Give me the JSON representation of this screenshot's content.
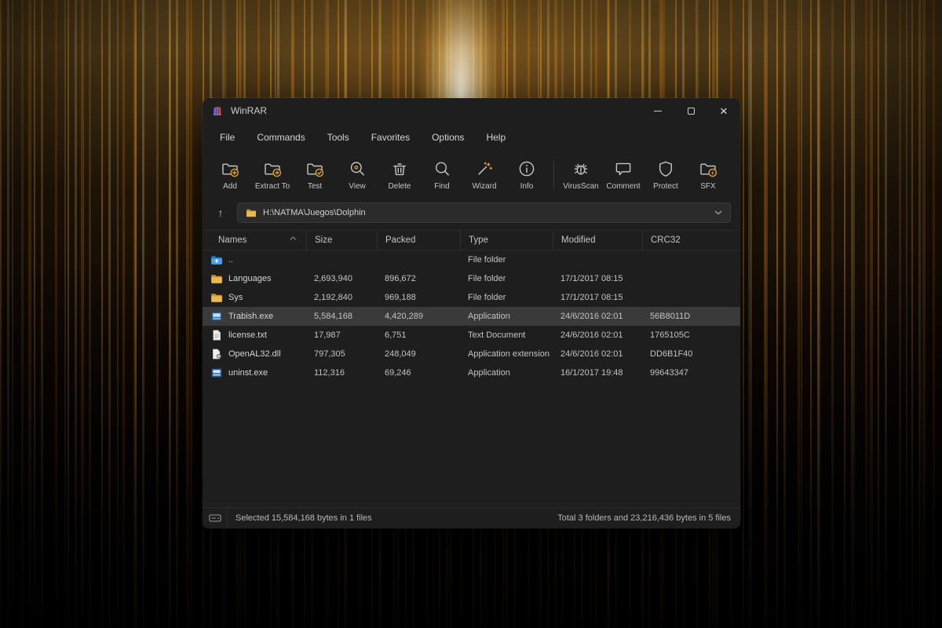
{
  "window": {
    "title": "WinRAR"
  },
  "colors": {
    "accent_gold": "#d9a13b",
    "window_bg": "#1e1e1e",
    "selection": "#3a3a3a",
    "folder_yellow": "#e9b850"
  },
  "menu": {
    "items": [
      "File",
      "Commands",
      "Tools",
      "Favorites",
      "Options",
      "Help"
    ]
  },
  "toolbar": {
    "buttons": [
      {
        "label": "Add",
        "icon": "add",
        "sep_after": false
      },
      {
        "label": "Extract To",
        "icon": "extract",
        "sep_after": false
      },
      {
        "label": "Test",
        "icon": "test",
        "sep_after": false
      },
      {
        "label": "View",
        "icon": "view",
        "sep_after": false
      },
      {
        "label": "Delete",
        "icon": "delete",
        "sep_after": false
      },
      {
        "label": "Find",
        "icon": "find",
        "sep_after": false
      },
      {
        "label": "Wizard",
        "icon": "wizard",
        "sep_after": false
      },
      {
        "label": "Info",
        "icon": "info",
        "sep_after": true
      },
      {
        "label": "VirusScan",
        "icon": "virusscan",
        "sep_after": false
      },
      {
        "label": "Comment",
        "icon": "comment",
        "sep_after": false
      },
      {
        "label": "Protect",
        "icon": "protect",
        "sep_after": false
      },
      {
        "label": "SFX",
        "icon": "sfx",
        "sep_after": false
      }
    ]
  },
  "address": {
    "path": "H:\\NATMA\\Juegos\\Dolphin",
    "up_icon": "up-arrow-icon",
    "folder_icon": "folder-icon",
    "dropdown_icon": "chevron-down-icon",
    "up_glyph": "↑"
  },
  "list": {
    "columns": [
      {
        "label": "Names",
        "sort": "asc"
      },
      {
        "label": "Size"
      },
      {
        "label": "Packed"
      },
      {
        "label": "Type"
      },
      {
        "label": "Modified"
      },
      {
        "label": "CRC32"
      }
    ],
    "sort_indicator": "^",
    "rows": [
      {
        "icon": "folder-up",
        "name": "..",
        "size": "",
        "packed": "",
        "type": "File folder",
        "modified": "",
        "crc": "",
        "selected": false
      },
      {
        "icon": "folder",
        "name": "Languages",
        "size": "2,693,940",
        "packed": "896,672",
        "type": "File folder",
        "modified": "17/1/2017 08:15",
        "crc": "",
        "selected": false
      },
      {
        "icon": "folder",
        "name": "Sys",
        "size": "2,192,840",
        "packed": "969,188",
        "type": "File folder",
        "modified": "17/1/2017 08:15",
        "crc": "",
        "selected": false
      },
      {
        "icon": "app",
        "name": "Trabish.exe",
        "size": "5,584,168",
        "packed": "4,420,289",
        "type": "Application",
        "modified": "24/6/2016 02:01",
        "crc": "56B8011D",
        "selected": true
      },
      {
        "icon": "doc",
        "name": "license.txt",
        "size": "17,987",
        "packed": "6,751",
        "type": "Text Document",
        "modified": "24/6/2016 02:01",
        "crc": "1765105C",
        "selected": false
      },
      {
        "icon": "dll",
        "name": "OpenAL32.dll",
        "size": "797,305",
        "packed": "248,049",
        "type": "Application extension",
        "modified": "24/6/2016 02:01",
        "crc": "DD6B1F40",
        "selected": false
      },
      {
        "icon": "exe",
        "name": "uninst.exe",
        "size": "112,316",
        "packed": "69,246",
        "type": "Application",
        "modified": "16/1/2017 19:48",
        "crc": "99643347",
        "selected": false
      }
    ]
  },
  "status": {
    "icon": "disk-icon",
    "left": "Selected 15,584,168 bytes in 1 files",
    "right": "Total 3 folders and 23,216,436 bytes in 5 files"
  }
}
